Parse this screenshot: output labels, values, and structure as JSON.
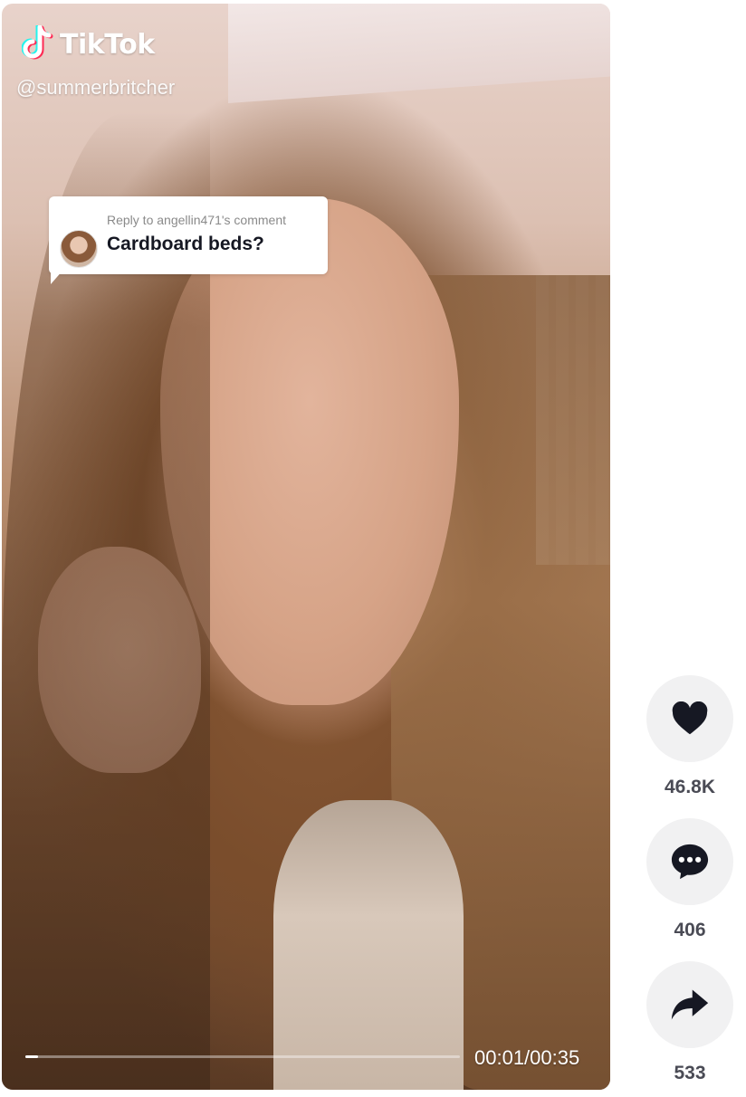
{
  "brand": {
    "name": "TikTok",
    "logo_icon": "tiktok-logo-icon",
    "accent_colors": [
      "#25F4EE",
      "#FE2C55"
    ]
  },
  "video": {
    "username": "@summerbritcher",
    "progress_percent": 3,
    "time_current": "00:01",
    "time_total": "00:35",
    "timecode": "00:01/00:35"
  },
  "reply": {
    "to_label": "Reply to angellin471's comment",
    "comment_text": "Cardboard beds?"
  },
  "actions": [
    {
      "id": "like",
      "icon": "heart-icon",
      "count": "46.8K"
    },
    {
      "id": "comment",
      "icon": "comment-icon",
      "count": "406"
    },
    {
      "id": "share",
      "icon": "share-icon",
      "count": "533"
    }
  ]
}
